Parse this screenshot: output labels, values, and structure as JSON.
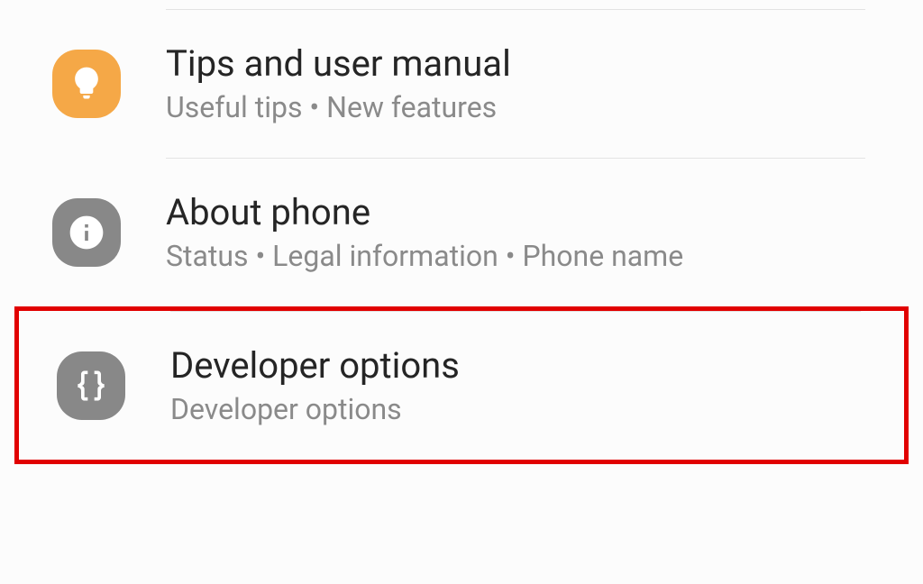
{
  "items": [
    {
      "title": "Tips and user manual",
      "subtitle": "Useful tips  •  New features"
    },
    {
      "title": "About phone",
      "subtitle": "Status  •  Legal information  •  Phone name"
    },
    {
      "title": "Developer options",
      "subtitle": "Developer options"
    }
  ]
}
